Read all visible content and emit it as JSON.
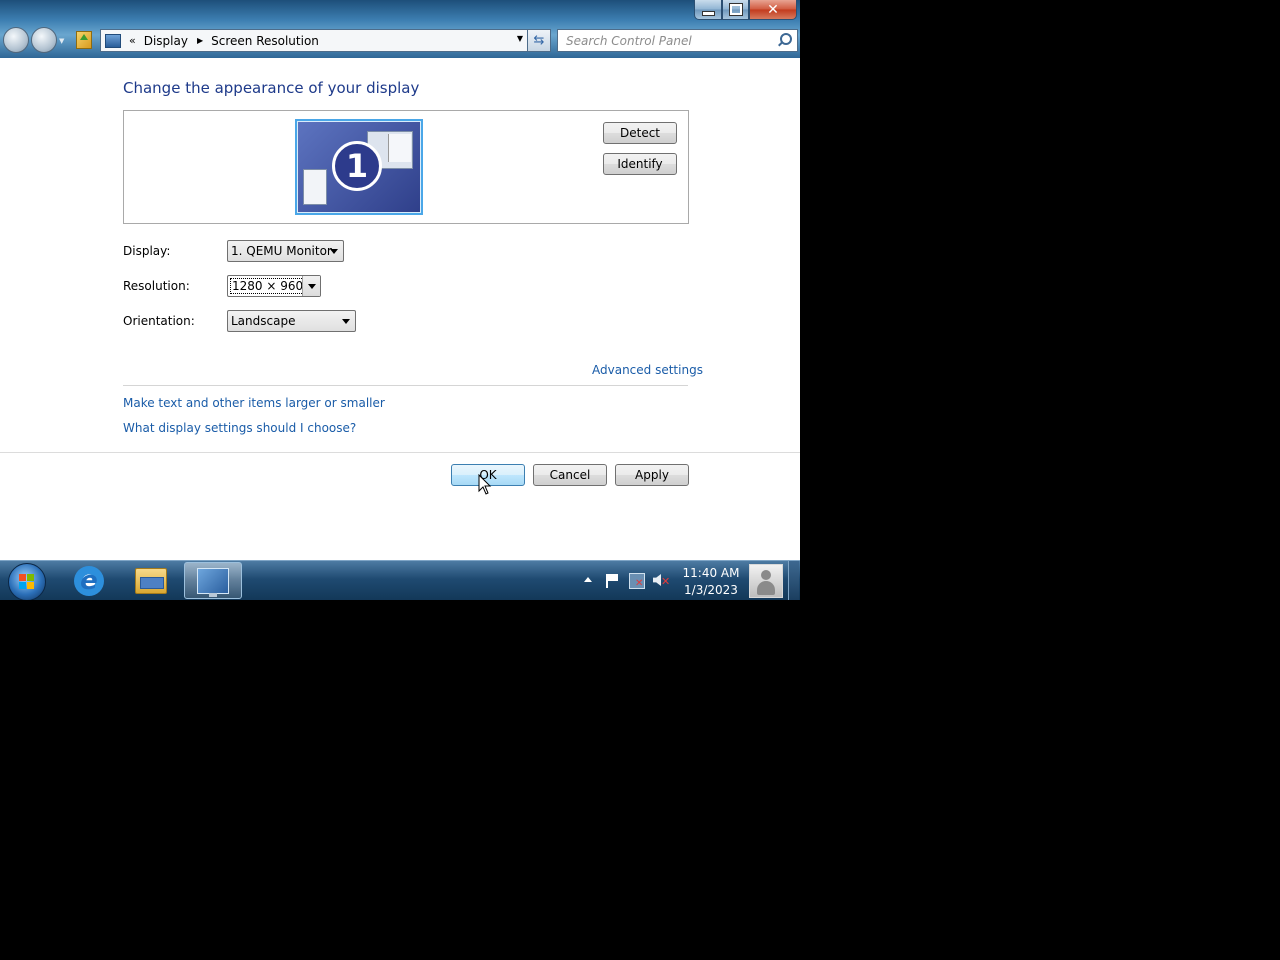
{
  "window": {
    "controls": {
      "minimize": "",
      "maximize": "",
      "close": "✕"
    }
  },
  "address": {
    "overflow_chevron": "«",
    "crumbs": [
      "Display",
      "Screen Resolution"
    ]
  },
  "search": {
    "placeholder": "Search Control Panel"
  },
  "main": {
    "heading": "Change the appearance of your display",
    "monitor_number": "1",
    "buttons": {
      "detect": "Detect",
      "identify": "Identify"
    },
    "fields": {
      "display": {
        "label": "Display:",
        "value": "1. QEMU Monitor"
      },
      "resolution": {
        "label": "Resolution:",
        "value": "1280 × 960"
      },
      "orientation": {
        "label": "Orientation:",
        "value": "Landscape"
      }
    },
    "links": {
      "advanced": "Advanced settings",
      "text_size": "Make text and other items larger or smaller",
      "help": "What display settings should I choose?"
    }
  },
  "footer": {
    "ok": "OK",
    "cancel": "Cancel",
    "apply": "Apply"
  },
  "taskbar": {
    "clock": {
      "time": "11:40 AM",
      "date": "1/3/2023"
    },
    "pinned": [
      "internet-explorer-icon",
      "windows-explorer-icon",
      "display-settings-icon"
    ],
    "active_item": "display-settings-icon"
  },
  "colors": {
    "heading": "#1e3a8a",
    "link": "#1a5ca8",
    "taskbar": "#1f4a71"
  }
}
